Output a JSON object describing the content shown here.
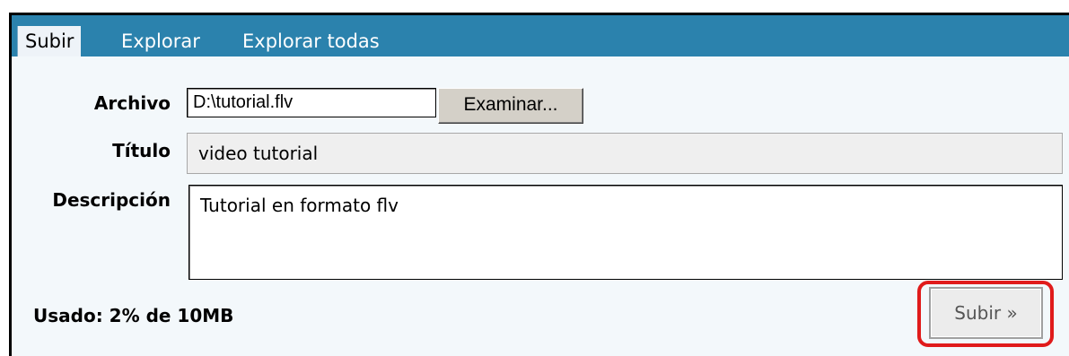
{
  "tabs": [
    {
      "label": "Subir",
      "active": true
    },
    {
      "label": "Explorar",
      "active": false
    },
    {
      "label": "Explorar todas",
      "active": false
    }
  ],
  "form": {
    "file": {
      "label": "Archivo",
      "value": "D:\\tutorial.flv",
      "browse_label": "Examinar..."
    },
    "title": {
      "label": "Título",
      "value": "video tutorial"
    },
    "description": {
      "label": "Descripción",
      "value": "Tutorial en formato flv"
    },
    "usage_text": "Usado: 2% de 10MB",
    "submit_label": "Subir »"
  },
  "colors": {
    "tab_bar": "#2b82ad",
    "panel_bg": "#f3f8fb",
    "highlight": "#e01b1b"
  }
}
